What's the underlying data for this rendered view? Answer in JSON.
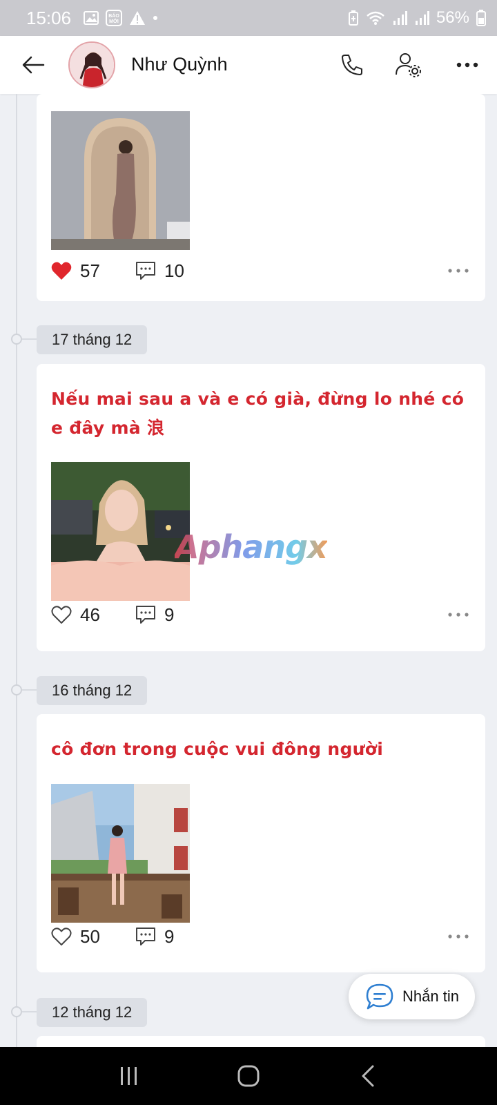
{
  "status_bar": {
    "time": "15:06",
    "news_badge_line1": "BÁO",
    "news_badge_line2": "MỚI",
    "battery": "56%"
  },
  "header": {
    "profile_name": "Như Quỳnh"
  },
  "posts": [
    {
      "date": "",
      "text": "",
      "likes": "57",
      "liked": true,
      "comments": "10",
      "photo_desc": "mirror-selfie"
    },
    {
      "date": "17 tháng 12",
      "text": "Nếu mai sau a và e có già, đừng lo nhé có e đây mà 浪",
      "likes": "46",
      "liked": false,
      "comments": "9",
      "photo_desc": "portrait-street-night"
    },
    {
      "date": "16 tháng 12",
      "text": "cô đơn trong cuộc vui đông người",
      "likes": "50",
      "liked": false,
      "comments": "9",
      "photo_desc": "cafe-balcony"
    },
    {
      "date": "12 tháng 12"
    }
  ],
  "watermark": "Aphangx",
  "message_button": {
    "label": "Nhắn tin"
  },
  "colors": {
    "accent_red": "#d4262f",
    "heart_red": "#e0262c",
    "fab_icon_blue": "#2f7fd1"
  }
}
